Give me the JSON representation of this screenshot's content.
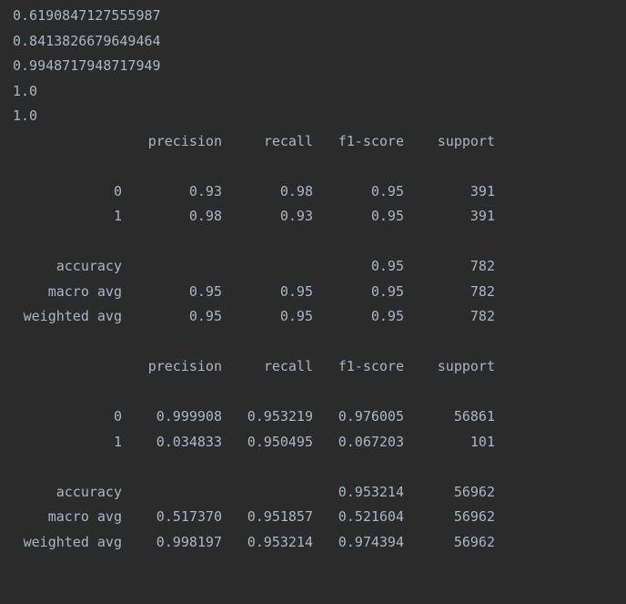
{
  "console": {
    "scores": [
      "0.6190847127555987",
      "0.8413826679649464",
      "0.9948717948717949",
      "1.0",
      "1.0"
    ],
    "reports": [
      {
        "header": {
          "label": "",
          "precision": "precision",
          "recall": "recall",
          "f1": "f1-score",
          "support": "support"
        },
        "rows": [
          {
            "label": "0",
            "precision": "0.93",
            "recall": "0.98",
            "f1": "0.95",
            "support": "391"
          },
          {
            "label": "1",
            "precision": "0.98",
            "recall": "0.93",
            "f1": "0.95",
            "support": "391"
          }
        ],
        "summary": [
          {
            "label": "accuracy",
            "precision": "",
            "recall": "",
            "f1": "0.95",
            "support": "782"
          },
          {
            "label": "macro avg",
            "precision": "0.95",
            "recall": "0.95",
            "f1": "0.95",
            "support": "782"
          },
          {
            "label": "weighted avg",
            "precision": "0.95",
            "recall": "0.95",
            "f1": "0.95",
            "support": "782"
          }
        ]
      },
      {
        "header": {
          "label": "",
          "precision": "precision",
          "recall": "recall",
          "f1": "f1-score",
          "support": "support"
        },
        "rows": [
          {
            "label": "0",
            "precision": "0.999908",
            "recall": "0.953219",
            "f1": "0.976005",
            "support": "56861"
          },
          {
            "label": "1",
            "precision": "0.034833",
            "recall": "0.950495",
            "f1": "0.067203",
            "support": "101"
          }
        ],
        "summary": [
          {
            "label": "accuracy",
            "precision": "",
            "recall": "",
            "f1": "0.953214",
            "support": "56962"
          },
          {
            "label": "macro avg",
            "precision": "0.517370",
            "recall": "0.951857",
            "f1": "0.521604",
            "support": "56962"
          },
          {
            "label": "weighted avg",
            "precision": "0.998197",
            "recall": "0.953214",
            "f1": "0.974394",
            "support": "56962"
          }
        ]
      }
    ]
  },
  "theme": {
    "background": "#2b2b2b",
    "text": "#a9b7c6"
  }
}
